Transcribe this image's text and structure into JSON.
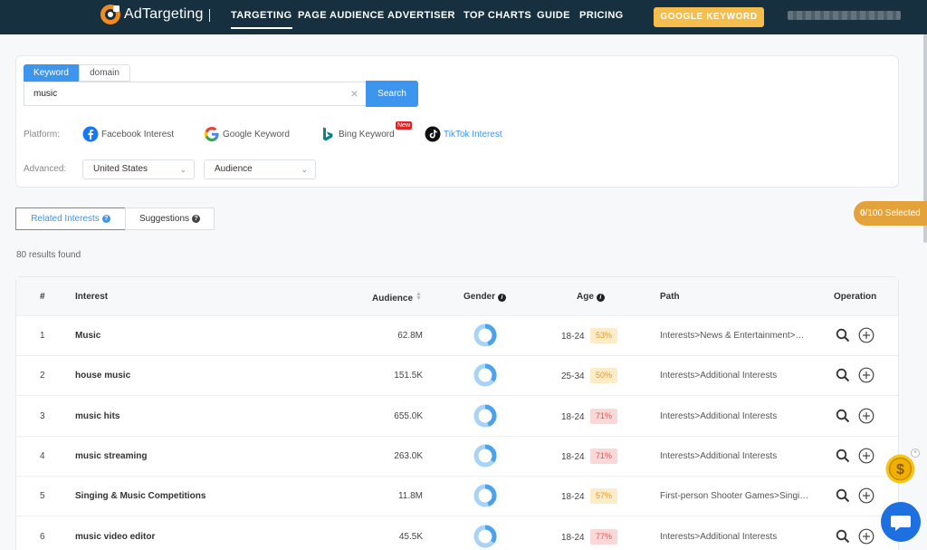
{
  "brand": {
    "name": "AdTargeting"
  },
  "nav": {
    "items": [
      "TARGETING",
      "PAGE AUDIENCE",
      "ADVERTISER",
      "TOP CHARTS",
      "GUIDE",
      "PRICING"
    ],
    "cta": "GOOGLE KEYWORD"
  },
  "search": {
    "tabs": [
      "Keyword",
      "domain"
    ],
    "value": "music",
    "button": "Search",
    "platform_label": "Platform:",
    "platforms": [
      "Facebook Interest",
      "Google Keyword",
      "Bing Keyword",
      "TikTok Interest"
    ],
    "active_platform": "TikTok Interest",
    "new_badge": "New",
    "advanced_label": "Advanced:",
    "country": "United States",
    "metric": "Audience"
  },
  "tabs": {
    "related": "Related Interests",
    "suggestions": "Suggestions"
  },
  "results_text": "80 results found",
  "selection": {
    "count": "0",
    "suffix": "/100 Selected"
  },
  "table": {
    "headers": {
      "num": "#",
      "interest": "Interest",
      "audience": "Audience",
      "gender": "Gender",
      "age": "Age",
      "path": "Path",
      "operation": "Operation"
    },
    "rows": [
      {
        "num": "1",
        "interest": "Music",
        "audience": "62.8M",
        "age": "18-24",
        "age_pct": "53%",
        "pct_color": "orange",
        "path": "Interests>News & Entertainment>C…"
      },
      {
        "num": "2",
        "interest": "house music",
        "audience": "151.5K",
        "age": "25-34",
        "age_pct": "50%",
        "pct_color": "orange",
        "path": "Interests>Additional Interests"
      },
      {
        "num": "3",
        "interest": "music hits",
        "audience": "655.0K",
        "age": "18-24",
        "age_pct": "71%",
        "pct_color": "red",
        "path": "Interests>Additional Interests"
      },
      {
        "num": "4",
        "interest": "music streaming",
        "audience": "263.0K",
        "age": "18-24",
        "age_pct": "71%",
        "pct_color": "red",
        "path": "Interests>Additional Interests"
      },
      {
        "num": "5",
        "interest": "Singing & Music Competitions",
        "audience": "11.8M",
        "age": "18-24",
        "age_pct": "57%",
        "pct_color": "orange",
        "path": "First-person Shooter Games>Singin…"
      },
      {
        "num": "6",
        "interest": "music video editor",
        "audience": "45.5K",
        "age": "18-24",
        "age_pct": "77%",
        "pct_color": "red",
        "path": "Interests>Additional Interests"
      }
    ]
  },
  "colors": {
    "nav_bg": "#16303f",
    "accent": "#3d95ee",
    "cta": "#f5bd4b",
    "pill": "#e3a33a"
  }
}
